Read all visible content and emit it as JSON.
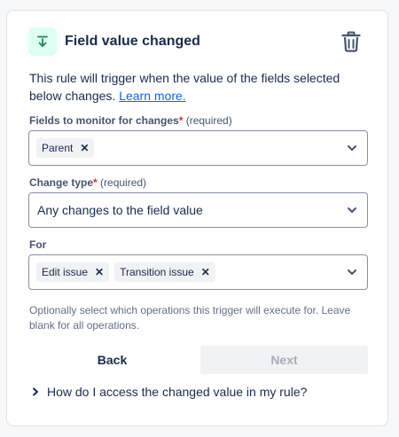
{
  "header": {
    "title": "Field value changed",
    "icon": "trigger-download-icon",
    "accent": "#1f845a",
    "delete_icon": "trash-icon"
  },
  "description": {
    "text": "This rule will trigger when the value of the fields selected below changes.",
    "link": "Learn more."
  },
  "fields_to_monitor": {
    "label": "Fields to monitor for changes",
    "required_marker": "*",
    "required_text": "(required)",
    "chips": [
      {
        "label": "Parent"
      }
    ]
  },
  "change_type": {
    "label": "Change type",
    "required_marker": "*",
    "required_text": "(required)",
    "value": "Any changes to the field value"
  },
  "for_field": {
    "label": "For",
    "chips": [
      {
        "label": "Edit issue"
      },
      {
        "label": "Transition issue"
      }
    ],
    "helper": "Optionally select which operations this trigger will execute for. Leave blank for all operations."
  },
  "actions": {
    "back": "Back",
    "next": "Next"
  },
  "faq": {
    "question": "How do I access the changed value in my rule?"
  }
}
